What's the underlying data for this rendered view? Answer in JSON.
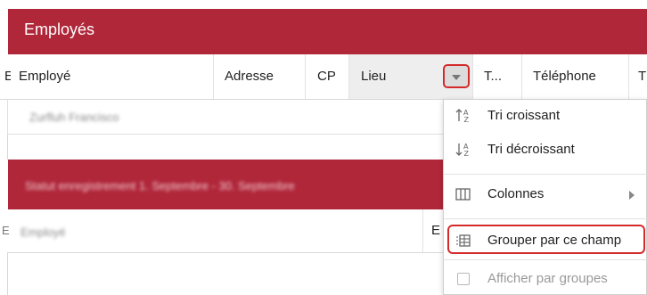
{
  "window": {
    "title": "Employés"
  },
  "grid": {
    "columns": [
      "E",
      "Employé",
      "Adresse",
      "CP",
      "Lieu",
      "T...",
      "Téléphone",
      "T"
    ],
    "rows": [
      {
        "employee": "Zurfluh Francisco"
      }
    ],
    "group": {
      "label": "Statut enregistrement 1. Septembre - 30. Septembre",
      "columns": [
        "E",
        "Employé",
        "E"
      ]
    }
  },
  "column_menu": {
    "items": [
      {
        "label": "Tri croissant",
        "icon": "sort-ascending-icon",
        "enabled": true
      },
      {
        "label": "Tri décroissant",
        "icon": "sort-descending-icon",
        "enabled": true
      },
      {
        "label": "Colonnes",
        "icon": "columns-icon",
        "has_submenu": true,
        "enabled": true
      },
      {
        "label": "Grouper par ce champ",
        "icon": "group-by-icon",
        "enabled": true,
        "highlighted": true
      },
      {
        "label": "Afficher par groupes",
        "icon": "checkbox-icon",
        "enabled": false
      }
    ]
  },
  "colors": {
    "accent": "#b0273a",
    "highlight": "#d42a2a"
  }
}
